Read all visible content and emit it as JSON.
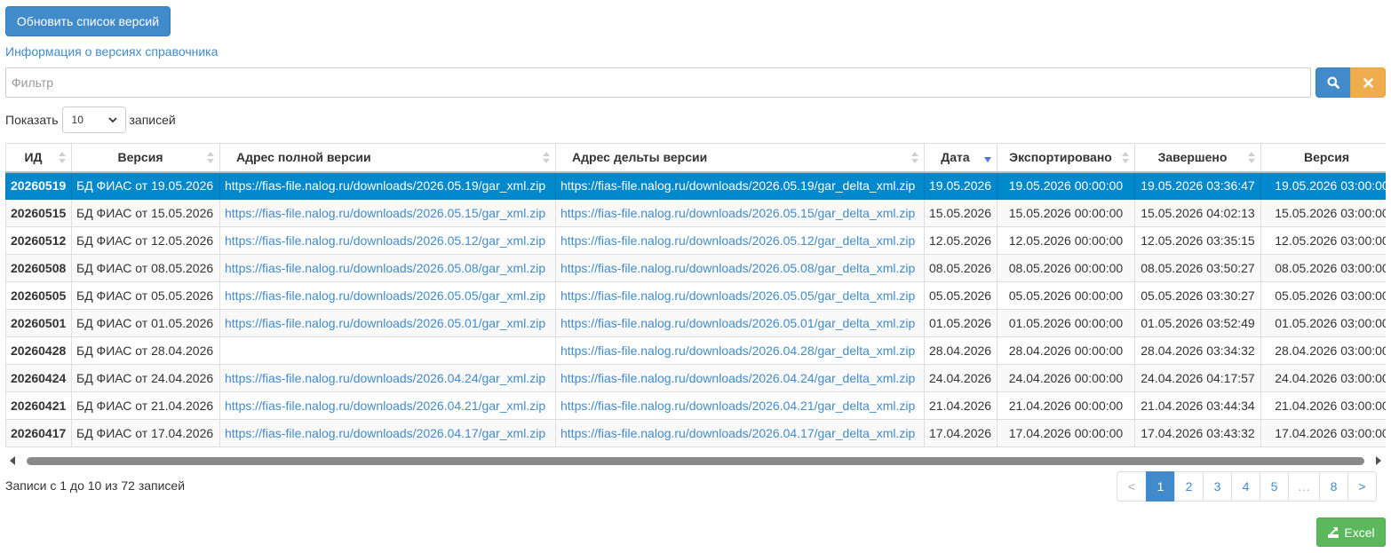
{
  "toolbar": {
    "refresh_label": "Обновить список версий",
    "info_link": "Информация о версиях справочника"
  },
  "filter": {
    "placeholder": "Фильтр",
    "search_icon": "search-icon",
    "clear_icon": "close-icon"
  },
  "length": {
    "prefix": "Показать",
    "selected": "10",
    "suffix": "записей"
  },
  "table": {
    "columns": [
      "ИД",
      "Версия",
      "Адрес полной версии",
      "Адрес дельты версии",
      "Дата",
      "Экспортировано",
      "Завершено",
      "Версия"
    ],
    "sorted_column": "Дата",
    "sort_direction": "desc",
    "selected_row_id": "20260519",
    "rows": [
      {
        "id": "20260519",
        "version": "БД ФИАС от 19.05.2026",
        "full_url": "https://fias-file.nalog.ru/downloads/2026.05.19/gar_xml.zip",
        "delta_url": "https://fias-file.nalog.ru/downloads/2026.05.19/gar_delta_xml.zip",
        "date": "19.05.2026",
        "exported": "19.05.2026 00:00:00",
        "completed": "19.05.2026 03:36:47",
        "version_ts": "19.05.2026 03:00:00"
      },
      {
        "id": "20260515",
        "version": "БД ФИАС от 15.05.2026",
        "full_url": "https://fias-file.nalog.ru/downloads/2026.05.15/gar_xml.zip",
        "delta_url": "https://fias-file.nalog.ru/downloads/2026.05.15/gar_delta_xml.zip",
        "date": "15.05.2026",
        "exported": "15.05.2026 00:00:00",
        "completed": "15.05.2026 04:02:13",
        "version_ts": "15.05.2026 03:00:00"
      },
      {
        "id": "20260512",
        "version": "БД ФИАС от 12.05.2026",
        "full_url": "https://fias-file.nalog.ru/downloads/2026.05.12/gar_xml.zip",
        "delta_url": "https://fias-file.nalog.ru/downloads/2026.05.12/gar_delta_xml.zip",
        "date": "12.05.2026",
        "exported": "12.05.2026 00:00:00",
        "completed": "12.05.2026 03:35:15",
        "version_ts": "12.05.2026 03:00:00"
      },
      {
        "id": "20260508",
        "version": "БД ФИАС от 08.05.2026",
        "full_url": "https://fias-file.nalog.ru/downloads/2026.05.08/gar_xml.zip",
        "delta_url": "https://fias-file.nalog.ru/downloads/2026.05.08/gar_delta_xml.zip",
        "date": "08.05.2026",
        "exported": "08.05.2026 00:00:00",
        "completed": "08.05.2026 03:50:27",
        "version_ts": "08.05.2026 03:00:00"
      },
      {
        "id": "20260505",
        "version": "БД ФИАС от 05.05.2026",
        "full_url": "https://fias-file.nalog.ru/downloads/2026.05.05/gar_xml.zip",
        "delta_url": "https://fias-file.nalog.ru/downloads/2026.05.05/gar_delta_xml.zip",
        "date": "05.05.2026",
        "exported": "05.05.2026 00:00:00",
        "completed": "05.05.2026 03:30:27",
        "version_ts": "05.05.2026 03:00:00"
      },
      {
        "id": "20260501",
        "version": "БД ФИАС от 01.05.2026",
        "full_url": "https://fias-file.nalog.ru/downloads/2026.05.01/gar_xml.zip",
        "delta_url": "https://fias-file.nalog.ru/downloads/2026.05.01/gar_delta_xml.zip",
        "date": "01.05.2026",
        "exported": "01.05.2026 00:00:00",
        "completed": "01.05.2026 03:52:49",
        "version_ts": "01.05.2026 03:00:00"
      },
      {
        "id": "20260428",
        "version": "БД ФИАС от 28.04.2026",
        "full_url": "",
        "delta_url": "https://fias-file.nalog.ru/downloads/2026.04.28/gar_delta_xml.zip",
        "date": "28.04.2026",
        "exported": "28.04.2026 00:00:00",
        "completed": "28.04.2026 03:34:32",
        "version_ts": "28.04.2026 03:00:00"
      },
      {
        "id": "20260424",
        "version": "БД ФИАС от 24.04.2026",
        "full_url": "https://fias-file.nalog.ru/downloads/2026.04.24/gar_xml.zip",
        "delta_url": "https://fias-file.nalog.ru/downloads/2026.04.24/gar_delta_xml.zip",
        "date": "24.04.2026",
        "exported": "24.04.2026 00:00:00",
        "completed": "24.04.2026 04:17:57",
        "version_ts": "24.04.2026 03:00:00"
      },
      {
        "id": "20260421",
        "version": "БД ФИАС от 21.04.2026",
        "full_url": "https://fias-file.nalog.ru/downloads/2026.04.21/gar_xml.zip",
        "delta_url": "https://fias-file.nalog.ru/downloads/2026.04.21/gar_delta_xml.zip",
        "date": "21.04.2026",
        "exported": "21.04.2026 00:00:00",
        "completed": "21.04.2026 03:44:34",
        "version_ts": "21.04.2026 03:00:00"
      },
      {
        "id": "20260417",
        "version": "БД ФИАС от 17.04.2026",
        "full_url": "https://fias-file.nalog.ru/downloads/2026.04.17/gar_xml.zip",
        "delta_url": "https://fias-file.nalog.ru/downloads/2026.04.17/gar_delta_xml.zip",
        "date": "17.04.2026",
        "exported": "17.04.2026 00:00:00",
        "completed": "17.04.2026 03:43:32",
        "version_ts": "17.04.2026 03:00:00"
      }
    ]
  },
  "footer": {
    "info": "Записи с 1 до 10 из 72 записей",
    "pages": [
      "<",
      "1",
      "2",
      "3",
      "4",
      "5",
      "…",
      "8",
      ">"
    ],
    "active_page": "1",
    "excel_label": "Excel"
  },
  "colors": {
    "primary": "#428bca",
    "selected_row": "#0088cc",
    "warning": "#f0ad4e",
    "success": "#5cb85c"
  }
}
